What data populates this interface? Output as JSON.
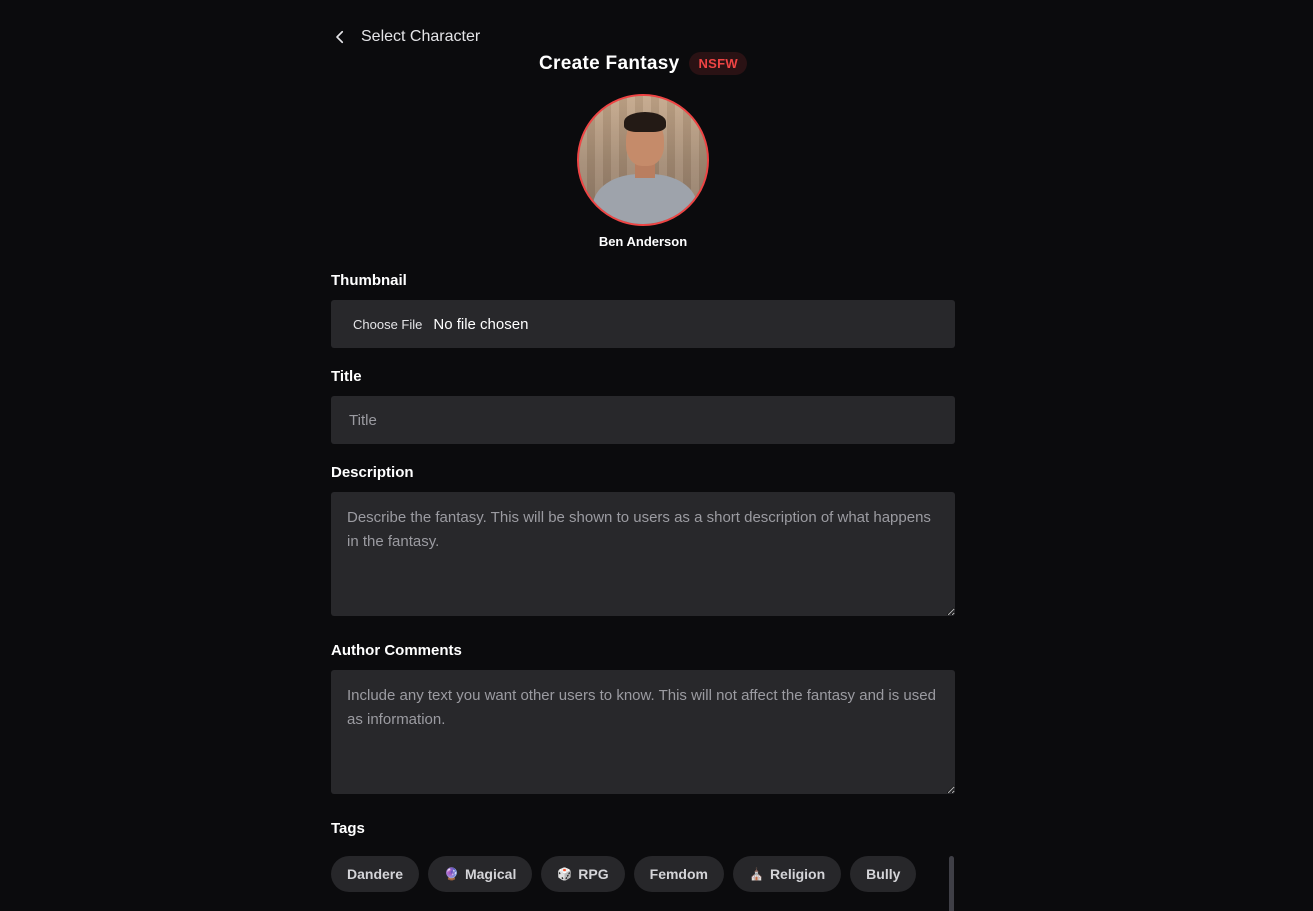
{
  "header": {
    "back_label": "Select Character",
    "title": "Create Fantasy",
    "badge": "NSFW"
  },
  "character": {
    "name": "Ben Anderson"
  },
  "thumbnail": {
    "label": "Thumbnail",
    "button_label": "Choose File",
    "status": "No file chosen"
  },
  "title_field": {
    "label": "Title",
    "placeholder": "Title"
  },
  "description": {
    "label": "Description",
    "placeholder": "Describe the fantasy. This will be shown to users as a short description of what happens in the fantasy."
  },
  "author_comments": {
    "label": "Author Comments",
    "placeholder": "Include any text you want other users to know. This will not affect the fantasy and is used as information."
  },
  "tags": {
    "label": "Tags",
    "items": [
      {
        "label": "Dandere",
        "icon": ""
      },
      {
        "label": "Magical",
        "icon": "🔮"
      },
      {
        "label": "RPG",
        "icon": "🎲"
      },
      {
        "label": "Femdom",
        "icon": ""
      },
      {
        "label": "Religion",
        "icon": "⛪"
      },
      {
        "label": "Bully",
        "icon": ""
      }
    ]
  },
  "colors": {
    "accent": "#ef4444",
    "background": "#0b0b0d",
    "field": "#28282b"
  }
}
